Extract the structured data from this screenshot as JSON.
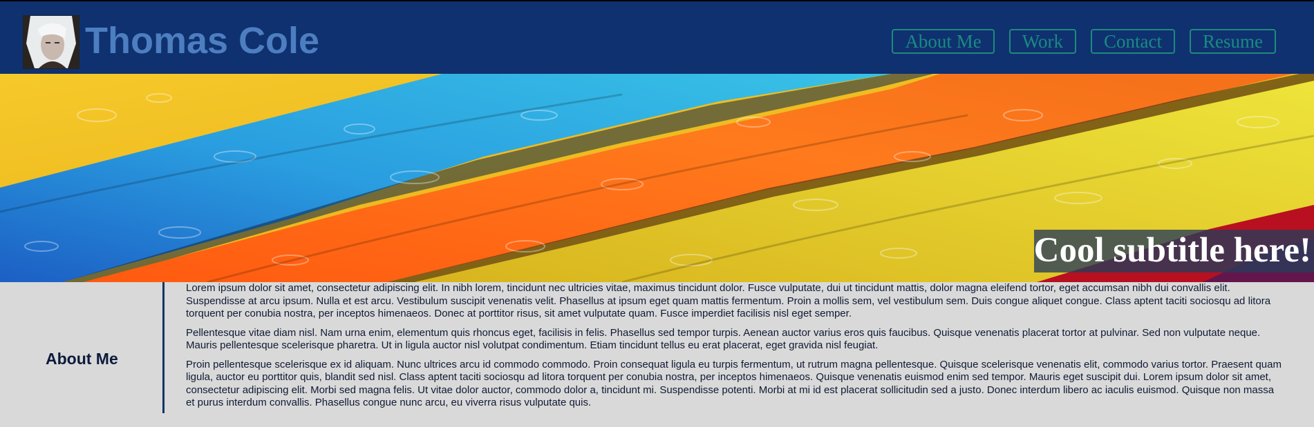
{
  "header": {
    "title": "Thomas Cole",
    "nav": [
      {
        "label": "About Me"
      },
      {
        "label": "Work"
      },
      {
        "label": "Contact"
      },
      {
        "label": "Resume"
      }
    ],
    "colors": {
      "bar": "#0f3170",
      "title": "#4c7ec0",
      "nav": "#1a8b80"
    }
  },
  "hero": {
    "subtitle": "Cool subtitle here!"
  },
  "about": {
    "heading": "About Me",
    "paragraphs": [
      "Lorem ipsum dolor sit amet, consectetur adipiscing elit. In nibh lorem, tincidunt nec ultricies vitae, maximus tincidunt dolor. Fusce vulputate, dui ut tincidunt mattis, dolor magna eleifend tortor, eget accumsan nibh dui convallis elit. Suspendisse at arcu ipsum. Nulla et est arcu. Vestibulum suscipit venenatis velit. Phasellus at ipsum eget quam mattis fermentum. Proin a mollis sem, vel vestibulum sem. Duis congue aliquet congue. Class aptent taciti sociosqu ad litora torquent per conubia nostra, per inceptos himenaeos. Donec at porttitor risus, sit amet vulputate quam. Fusce imperdiet facilisis nisl eget semper.",
      "Pellentesque vitae diam nisl. Nam urna enim, elementum quis rhoncus eget, facilisis in felis. Phasellus sed tempor turpis. Aenean auctor varius eros quis faucibus. Quisque venenatis placerat tortor at pulvinar. Sed non vulputate neque. Mauris pellentesque scelerisque pharetra. Ut in ligula auctor nisl volutpat condimentum. Etiam tincidunt tellus eu erat placerat, eget gravida nisl feugiat.",
      "Proin pellentesque scelerisque ex id aliquam. Nunc ultrices arcu id commodo commodo. Proin consequat ligula eu turpis fermentum, ut rutrum magna pellentesque. Quisque scelerisque venenatis elit, commodo varius tortor. Praesent quam ligula, auctor eu porttitor quis, blandit sed nisl. Class aptent taciti sociosqu ad litora torquent per conubia nostra, per inceptos himenaeos. Quisque venenatis euismod enim sed tempor. Mauris eget suscipit dui. Lorem ipsum dolor sit amet, consectetur adipiscing elit. Morbi sed magna felis. Ut vitae dolor auctor, commodo dolor a, tincidunt mi. Suspendisse potenti. Morbi at mi id est placerat sollicitudin sed a justo. Donec interdum libero ac iaculis euismod. Quisque non massa et purus interdum convallis. Phasellus congue nunc arcu, eu viverra risus vulputate quis."
    ]
  }
}
